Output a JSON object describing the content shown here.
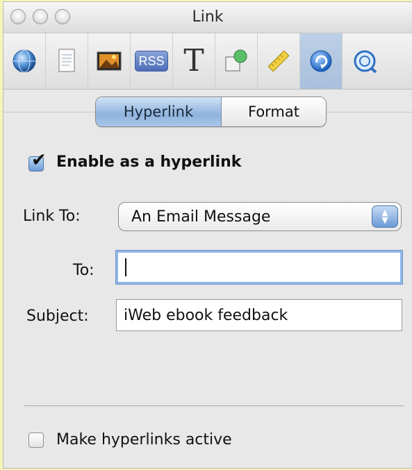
{
  "window": {
    "title": "Link"
  },
  "toolbar": {
    "tools": [
      {
        "name": "document-globe",
        "icon": "globe-icon"
      },
      {
        "name": "page",
        "icon": "page-icon"
      },
      {
        "name": "photo",
        "icon": "photo-icon"
      },
      {
        "name": "rss",
        "icon": "rss-icon",
        "label": "RSS"
      },
      {
        "name": "text",
        "icon": "text-icon",
        "label": "T"
      },
      {
        "name": "graphic",
        "icon": "shape-icon"
      },
      {
        "name": "metrics",
        "icon": "ruler-icon"
      },
      {
        "name": "link",
        "icon": "link-icon",
        "active": true
      },
      {
        "name": "qt",
        "icon": "quicktime-icon"
      }
    ]
  },
  "tabs": [
    {
      "label": "Hyperlink",
      "selected": true
    },
    {
      "label": "Format",
      "selected": false
    }
  ],
  "enable_hyperlink": {
    "label": "Enable as a hyperlink",
    "checked": true
  },
  "link_to": {
    "label": "Link To:",
    "value": "An Email Message"
  },
  "to_field": {
    "label": "To:",
    "value": ""
  },
  "subject_field": {
    "label": "Subject:",
    "value": "iWeb ebook feedback"
  },
  "make_active": {
    "label": "Make hyperlinks active",
    "checked": false
  },
  "colors": {
    "accent": "#8fb3dd",
    "window_bg": "#e8e8e8",
    "page_bg": "#f6f5b8"
  }
}
